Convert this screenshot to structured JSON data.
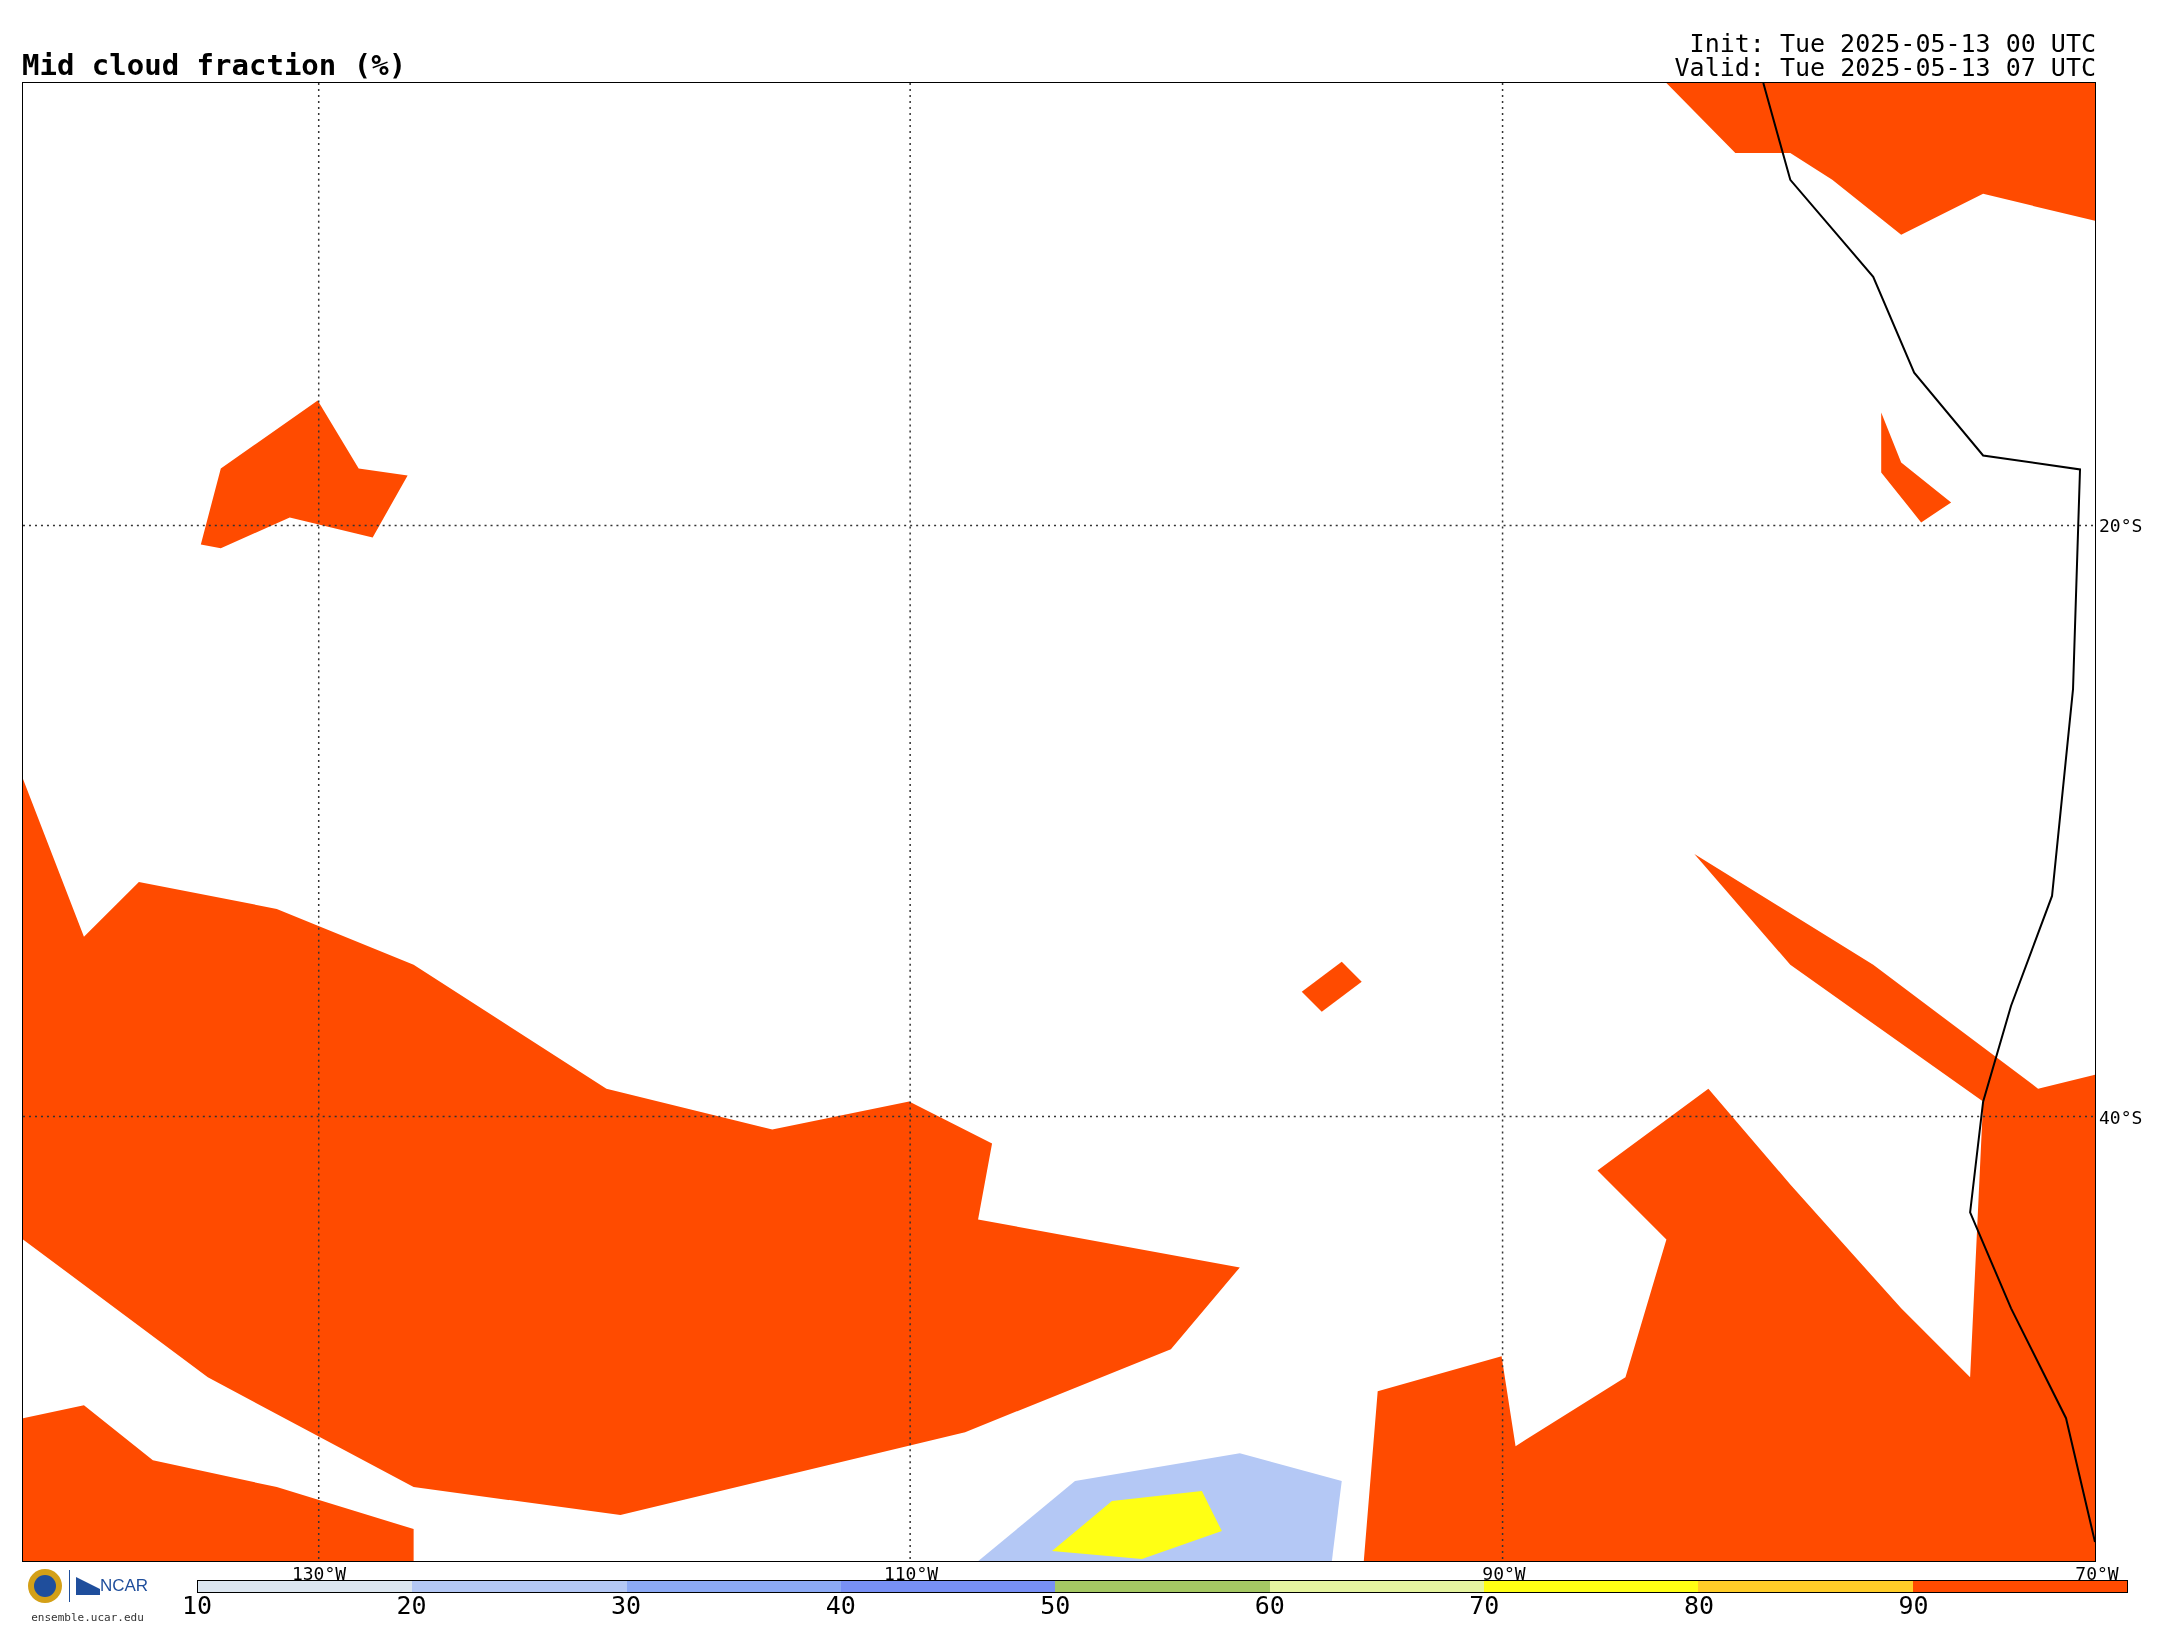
{
  "title": "Mid cloud fraction (%)",
  "times": [
    "Init: Tue 2025-05-13 00 UTC",
    "Valid: Tue 2025-05-13 07 UTC"
  ],
  "map": {
    "lat_labels": [
      "20°S",
      "40°S"
    ],
    "lon_labels": [
      "130°W",
      "110°W",
      "90°W",
      "70°W"
    ]
  },
  "credit": {
    "logo_text": "NCAR",
    "site": "ensemble.ucar.edu"
  },
  "colorbar": {
    "segments": [
      {
        "color": "#dce6f0"
      },
      {
        "color": "#b4c8f5"
      },
      {
        "color": "#8caaf5"
      },
      {
        "color": "#7890f5"
      },
      {
        "color": "#a5c864"
      },
      {
        "color": "#e6f5a0"
      },
      {
        "color": "#ffff14"
      },
      {
        "color": "#ffcd28"
      },
      {
        "color": "#ff4b00"
      }
    ],
    "ticks": [
      "10",
      "20",
      "30",
      "40",
      "50",
      "60",
      "70",
      "80",
      "90"
    ]
  }
}
